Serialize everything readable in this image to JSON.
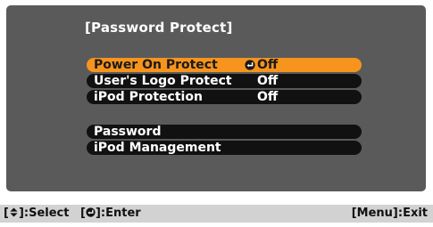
{
  "menu": {
    "title": "[Password Protect]",
    "items": [
      {
        "label": "Power On Protect",
        "value": "Off",
        "selected": true
      },
      {
        "label": "User's Logo Protect",
        "value": "Off",
        "selected": false
      },
      {
        "label": "iPod Protection",
        "value": "Off",
        "selected": false
      },
      {
        "label": "Password",
        "value": "",
        "selected": false
      },
      {
        "label": "iPod Management",
        "value": "",
        "selected": false
      }
    ]
  },
  "footer": {
    "select_open": "[",
    "select_close": "]:Select",
    "enter_open": "[",
    "enter_close": "]:Enter",
    "exit_label": "[Menu]:Exit"
  },
  "colors": {
    "panel": "#5a5a5a",
    "row": "#111111",
    "selected": "#f7941d",
    "footer": "#d2d2d2"
  },
  "icons": {
    "enter": "enter-return-icon",
    "select": "up-down-arrow-icon"
  }
}
